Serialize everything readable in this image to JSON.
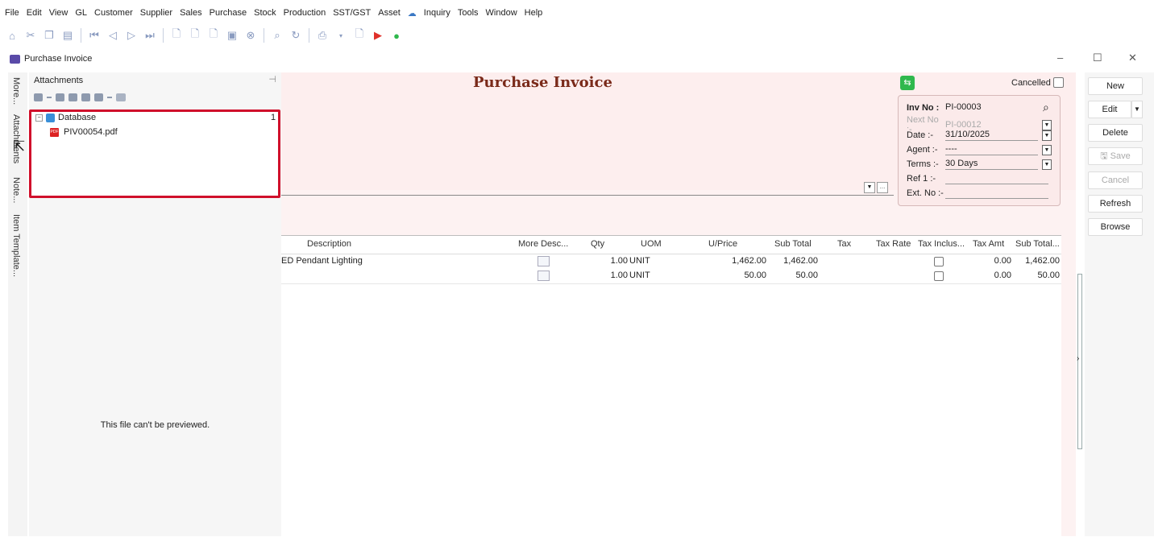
{
  "menu": [
    "File",
    "Edit",
    "View",
    "GL",
    "Customer",
    "Supplier",
    "Sales",
    "Purchase",
    "Stock",
    "Production",
    "SST/GST",
    "Asset",
    "Inquiry",
    "Tools",
    "Window",
    "Help"
  ],
  "window": {
    "title": "Purchase Invoice"
  },
  "vtabs": [
    "More...",
    "Attachments",
    "Note...",
    "Item Template..."
  ],
  "attachments": {
    "title": "Attachments",
    "tree": {
      "root": "Database",
      "count": "1",
      "file": "PIV00054.pdf"
    },
    "preview_text": "This file can't be previewed."
  },
  "form": {
    "title": "Purchase Invoice",
    "cancelled_label": "Cancelled",
    "inv_no_label": "Inv No :",
    "inv_no": "PI-00003",
    "next_no_label": "Next No :-",
    "next_no": "PI-00012",
    "date_label": "Date :-",
    "date": "31/10/2025",
    "agent_label": "Agent :-",
    "agent": "----",
    "terms_label": "Terms :-",
    "terms": "30 Days",
    "ref1_label": "Ref 1 :-",
    "ext_no_label": "Ext. No :-"
  },
  "grid": {
    "headers": {
      "description": "Description",
      "more_desc": "More Desc...",
      "qty": "Qty",
      "uom": "UOM",
      "uprice": "U/Price",
      "subtotal": "Sub Total",
      "tax": "Tax",
      "taxrate": "Tax Rate",
      "taxincl": "Tax Inclus...",
      "taxamt": "Tax Amt",
      "subtotal2": "Sub Total..."
    },
    "rows": [
      {
        "description": "ED Pendant Lighting",
        "qty": "1.00",
        "uom": "UNIT",
        "uprice": "1,462.00",
        "subtotal": "1,462.00",
        "taxamt": "0.00",
        "subtotal2": "1,462.00"
      },
      {
        "description": "",
        "qty": "1.00",
        "uom": "UNIT",
        "uprice": "50.00",
        "subtotal": "50.00",
        "taxamt": "0.00",
        "subtotal2": "50.00"
      }
    ]
  },
  "buttons": {
    "new": "New",
    "edit": "Edit",
    "delete": "Delete",
    "save": "Save",
    "cancel": "Cancel",
    "refresh": "Refresh",
    "browse": "Browse"
  },
  "colors": {
    "accent_red": "#d0102b",
    "title_brown": "#7a2a1a",
    "share_green": "#2fb84d"
  }
}
